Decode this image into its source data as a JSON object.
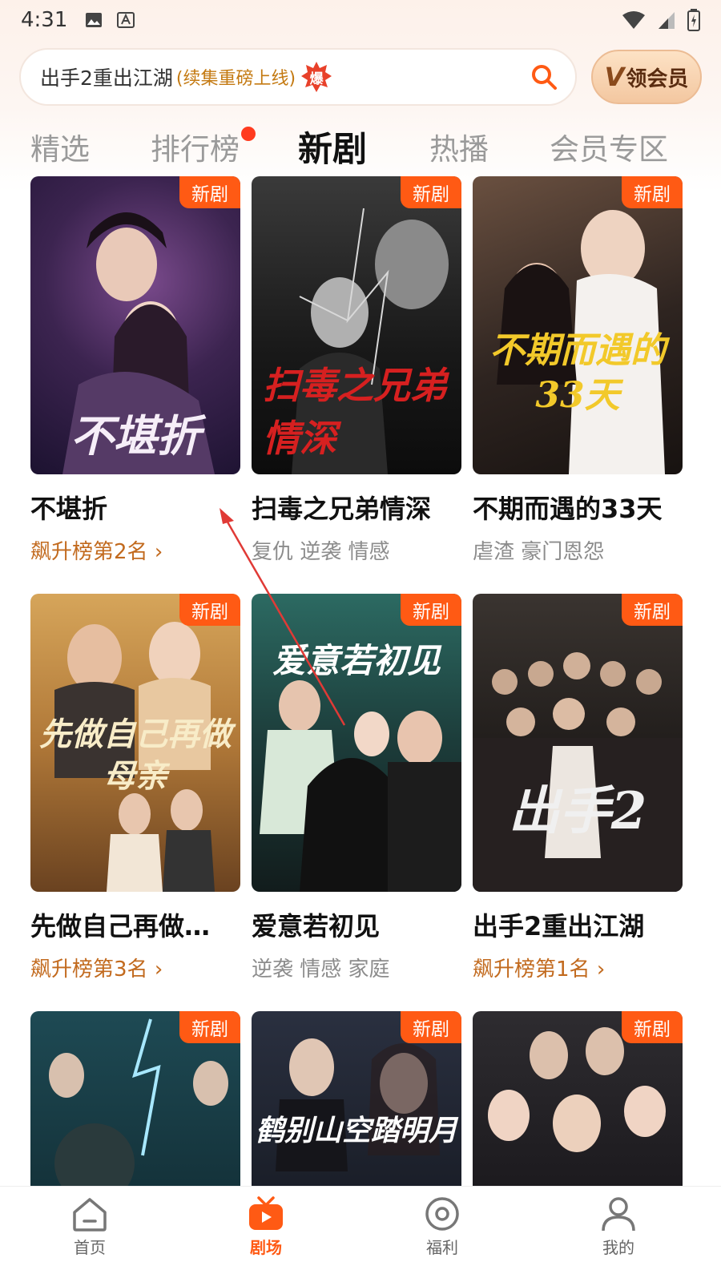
{
  "status_bar": {
    "time": "4:31"
  },
  "search": {
    "main_text": "出手2重出江湖",
    "sub_text": "(续集重磅上线)",
    "badge": "爆"
  },
  "vip": {
    "v_letter": "V",
    "label": "领会员"
  },
  "tabs": [
    {
      "label": "精选"
    },
    {
      "label": "排行榜"
    },
    {
      "label": "新剧"
    },
    {
      "label": "热播"
    },
    {
      "label": "会员专区"
    }
  ],
  "badge_new": "新剧",
  "cards": [
    {
      "title": "不堪折",
      "poster_text": "不堪折",
      "sub": "飙升榜第2名",
      "sub_type": "rank"
    },
    {
      "title": "扫毒之兄弟情深",
      "poster_text": "扫毒之兄弟情深",
      "sub": "复仇 逆袭 情感",
      "sub_type": "tags"
    },
    {
      "title": "不期而遇的33天",
      "poster_text": "不期而遇的33天",
      "sub": "虐渣 豪门恩怨",
      "sub_type": "tags"
    },
    {
      "title": "先做自己再做…",
      "poster_text": "先做自己再做母亲",
      "sub": "飙升榜第3名",
      "sub_type": "rank"
    },
    {
      "title": "爱意若初见",
      "poster_text": "爱意若初见",
      "sub": "逆袭 情感 家庭",
      "sub_type": "tags"
    },
    {
      "title": "出手2重出江湖",
      "poster_text": "出手2",
      "sub": "飙升榜第1名",
      "sub_type": "rank"
    },
    {
      "title": "",
      "poster_text": "",
      "sub": "",
      "sub_type": "tags"
    },
    {
      "title": "",
      "poster_text": "鹤别山空踏明月",
      "sub": "",
      "sub_type": "tags"
    },
    {
      "title": "",
      "poster_text": "",
      "sub": "",
      "sub_type": "tags"
    }
  ],
  "bottom_nav": [
    {
      "label": "首页",
      "icon": "home-icon"
    },
    {
      "label": "剧场",
      "icon": "theater-icon"
    },
    {
      "label": "福利",
      "icon": "welfare-icon"
    },
    {
      "label": "我的",
      "icon": "profile-icon"
    }
  ],
  "colors": {
    "accent": "#ff5a14",
    "rank_text": "#c26a1e",
    "tab_dot": "#ff3b1f"
  }
}
